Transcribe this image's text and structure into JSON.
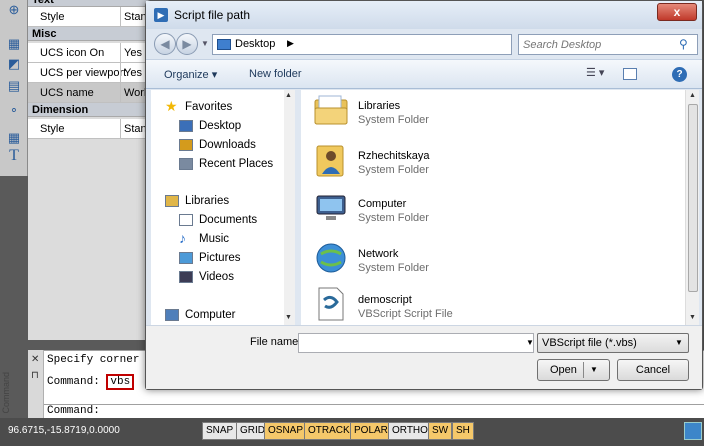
{
  "properties": {
    "partial_header": "Text",
    "rows": [
      {
        "type": "row",
        "name": "Style",
        "value": "Standard"
      },
      {
        "type": "cat",
        "name": "Misc"
      },
      {
        "type": "row",
        "name": "UCS icon On",
        "value": "Yes"
      },
      {
        "type": "row",
        "name": "UCS per viewport",
        "value": "Yes"
      },
      {
        "type": "row",
        "name": "UCS name",
        "value": "World",
        "selected": true
      },
      {
        "type": "cat",
        "name": "Dimension"
      },
      {
        "type": "row",
        "name": "Style",
        "value": "Standard"
      }
    ]
  },
  "command_line": {
    "line1": "Specify corner o",
    "line2_prefix": "Command: ",
    "line2_cmd": "vbs",
    "prompt": "Command:",
    "side_label": "Command"
  },
  "status_bar": {
    "coordinates": "96.6715,-15.8719,0.0000",
    "buttons": [
      {
        "label": "SNAP",
        "on": false
      },
      {
        "label": "GRID",
        "on": false
      },
      {
        "label": "OSNAP",
        "on": true
      },
      {
        "label": "OTRACK",
        "on": true
      },
      {
        "label": "POLAR",
        "on": true
      },
      {
        "label": "ORTHO",
        "on": false
      },
      {
        "label": "SW",
        "on": true
      },
      {
        "label": "SH",
        "on": true
      }
    ]
  },
  "dialog": {
    "title": "Script file path",
    "close_label": "x",
    "address": "Desktop",
    "search_placeholder": "Search Desktop",
    "organize_label": "Organize ▾",
    "new_folder_label": "New folder",
    "nav": [
      {
        "label": "Favorites",
        "icon": "star-icon"
      },
      {
        "label": "Desktop",
        "icon": "desktop-icon"
      },
      {
        "label": "Downloads",
        "icon": "downloads-icon"
      },
      {
        "label": "Recent Places",
        "icon": "recent-places-icon"
      },
      {
        "label": "Libraries",
        "icon": "libraries-icon"
      },
      {
        "label": "Documents",
        "icon": "documents-icon"
      },
      {
        "label": "Music",
        "icon": "music-icon"
      },
      {
        "label": "Pictures",
        "icon": "pictures-icon"
      },
      {
        "label": "Videos",
        "icon": "videos-icon"
      },
      {
        "label": "Computer",
        "icon": "computer-icon"
      }
    ],
    "files": [
      {
        "name": "Libraries",
        "type": "System Folder",
        "icon": "libraries-folder-icon"
      },
      {
        "name": "Rzhechitskaya",
        "type": "System Folder",
        "icon": "user-folder-icon"
      },
      {
        "name": "Computer",
        "type": "System Folder",
        "icon": "computer-icon"
      },
      {
        "name": "Network",
        "type": "System Folder",
        "icon": "network-icon"
      },
      {
        "name": "demoscript",
        "type": "VBScript Script File",
        "icon": "vbscript-file-icon"
      }
    ],
    "file_name_label": "File name:",
    "file_name_value": "",
    "file_type": "VBScript file (*.vbs)",
    "open_label": "Open",
    "cancel_label": "Cancel",
    "colors": {
      "accent": "#2f6db5",
      "highlight_border": "#c00000"
    }
  }
}
